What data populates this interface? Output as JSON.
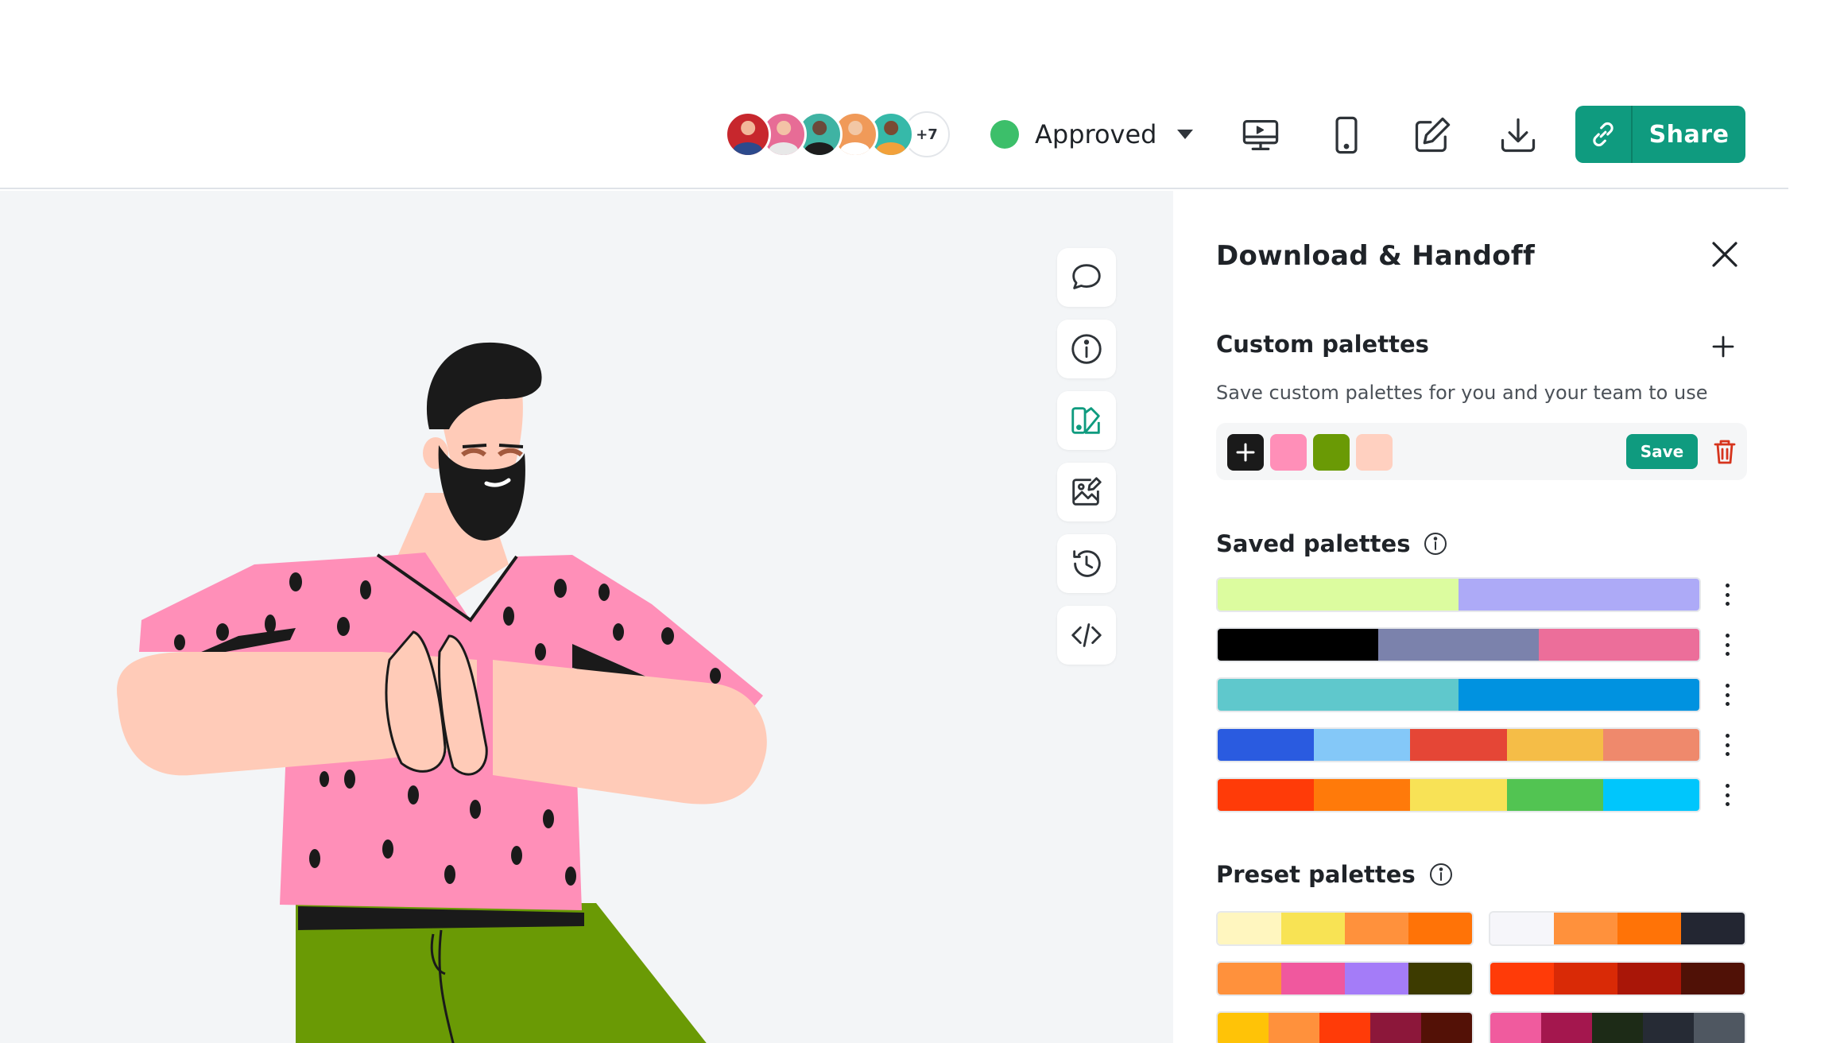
{
  "header": {
    "avatars": [
      {
        "bg": "#c7272d",
        "face": "#f2b79a",
        "body": "#2c4a8c"
      },
      {
        "bg": "#e76c96",
        "face": "#f3c2a6",
        "body": "#e8e8e8"
      },
      {
        "bg": "#3fb3a3",
        "face": "#6b4a3a",
        "body": "#1d1d1d"
      },
      {
        "bg": "#f09a59",
        "face": "#f2c7a5",
        "body": "#ffffff"
      },
      {
        "bg": "#36b9a9",
        "face": "#7a4a33",
        "body": "#f2a13b"
      }
    ],
    "avatars_more": "+7",
    "status": {
      "label": "Approved",
      "color": "#3cbf6a"
    },
    "tools": [
      "desktop-preview-icon",
      "mobile-preview-icon",
      "edit-icon",
      "download-icon"
    ],
    "share_label": "Share"
  },
  "side_tools": [
    "comment-icon",
    "info-icon",
    "palette-icon",
    "image-edit-icon",
    "history-icon",
    "code-icon"
  ],
  "panel": {
    "title": "Download & Handoff",
    "custom": {
      "title": "Custom palettes",
      "description": "Save custom palettes for you and your team to use",
      "swatches": [
        "#ff8fb8",
        "#6a9a05",
        "#ffd0c0"
      ],
      "save_label": "Save"
    },
    "saved": {
      "title": "Saved palettes",
      "rows": [
        [
          "#dcfc9f",
          "#adaaf7"
        ],
        [
          "#000000",
          "#7b82ac",
          "#ec6e9a"
        ],
        [
          "#5fc8cc",
          "#0092e0"
        ],
        [
          "#2a5be0",
          "#84c8f8",
          "#e54636",
          "#f5bd47",
          "#ef896c"
        ],
        [
          "#ff3b08",
          "#ff7a0a",
          "#f8e256",
          "#52c452",
          "#00c6fc"
        ]
      ]
    },
    "preset": {
      "title": "Preset palettes",
      "rows": [
        [
          "#fff6bf",
          "#f8e354",
          "#ff913c",
          "#ff7307"
        ],
        [
          "#f6f6fa",
          "#ff913c",
          "#ff7307",
          "#232632"
        ],
        [
          "#ff913c",
          "#f0589e",
          "#a47cf8",
          "#3d3b00"
        ],
        [
          "#ff3b08",
          "#d92a06",
          "#a91608",
          "#501106"
        ],
        [
          "#ffc307",
          "#ff913c",
          "#ff3b08",
          "#8c173a",
          "#531106"
        ],
        [
          "#f05b9e",
          "#a4174e",
          "#1d2b17",
          "#262b35",
          "#4f5761"
        ]
      ]
    }
  }
}
